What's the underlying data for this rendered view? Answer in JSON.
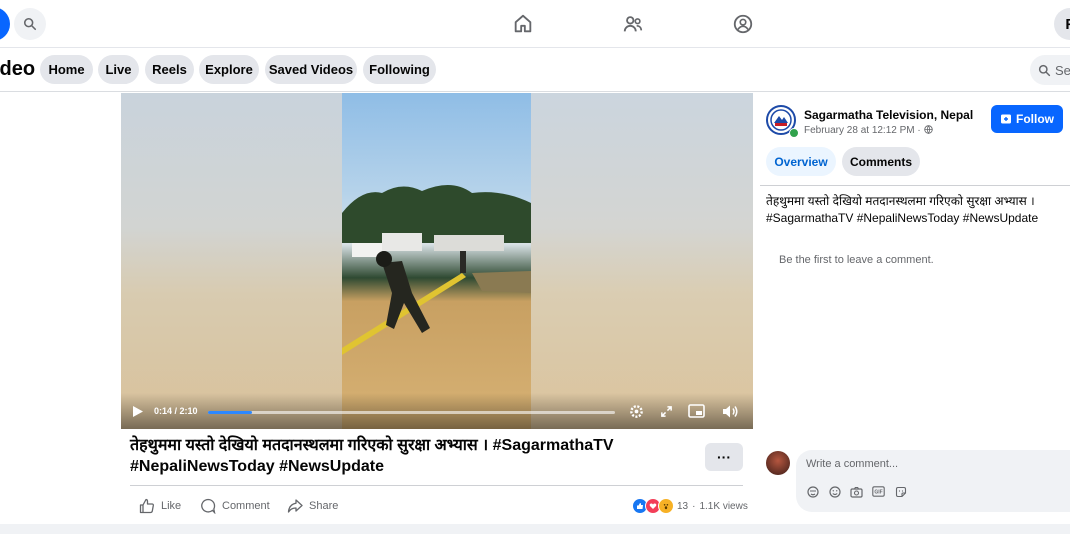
{
  "topbar": {
    "profile_initial": "F",
    "nav_icons": [
      "home-icon",
      "friends-icon",
      "groups-icon"
    ]
  },
  "subnav": {
    "title": "ideo",
    "pills": [
      "Home",
      "Live",
      "Reels",
      "Explore",
      "Saved Videos",
      "Following"
    ],
    "search_placeholder": "Sea"
  },
  "video": {
    "time": "0:14 / 2:10",
    "progress": 0.108,
    "title": "तेहथुममा यस्तो देखियो मतदानस्थलमा गरिएको सुरक्षा अभ्यास । #SagarmathaTV #NepaliNewsToday #NewsUpdate",
    "more_label": "···",
    "actions": [
      "Like",
      "Comment",
      "Share"
    ],
    "reaction_count": "13",
    "views": "1.1K views",
    "separator": "·"
  },
  "sidebar": {
    "page_name": "Sagarmatha Television, Nepal",
    "date": "February 28 at 12:12 PM · ",
    "follow_label": "Follow",
    "tabs": [
      "Overview",
      "Comments"
    ],
    "description_line1": "तेहथुममा यस्तो देखियो मतदानस्थलमा गरिएको सुरक्षा अभ्यास ।",
    "description_line2": "#SagarmathaTV #NepaliNewsToday #NewsUpdate",
    "empty_comments": "Be the first to leave a comment.",
    "compose_placeholder": "Write a comment..."
  },
  "colors": {
    "accent": "#0866ff",
    "tab_active_bg": "#ebf5ff",
    "tab_active_text": "#0064d1"
  }
}
